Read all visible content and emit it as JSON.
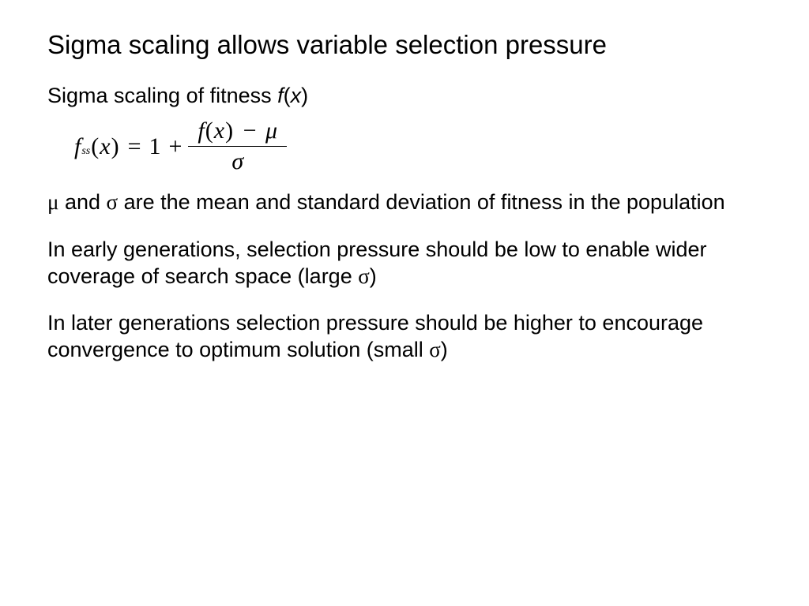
{
  "title": "Sigma scaling allows variable selection pressure",
  "subtitle": {
    "lead": "Sigma scaling of fitness ",
    "func": "f",
    "arg_open": "(",
    "arg": "x",
    "arg_close": ")"
  },
  "equation": {
    "lhs_f": "f",
    "lhs_sub": "ss",
    "lhs_open": "(",
    "lhs_x": "x",
    "lhs_close": ")",
    "eq": "=",
    "one": "1",
    "plus": "+",
    "num_f": "f",
    "num_open": "(",
    "num_x": "x",
    "num_close": ")",
    "num_minus": "−",
    "mu": "μ",
    "sigma": "σ"
  },
  "p1": {
    "mu": "μ",
    "mid": " and ",
    "sigma": "σ",
    "rest": " are the mean and standard deviation of fitness in the population"
  },
  "p2": {
    "text": "In early generations, selection pressure should be low to enable wider coverage of search space (large ",
    "sigma": "σ",
    "close": ")"
  },
  "p3": {
    "text": "In later generations selection pressure should be higher to encourage convergence to optimum solution (small ",
    "sigma": "σ",
    "close": ")"
  }
}
